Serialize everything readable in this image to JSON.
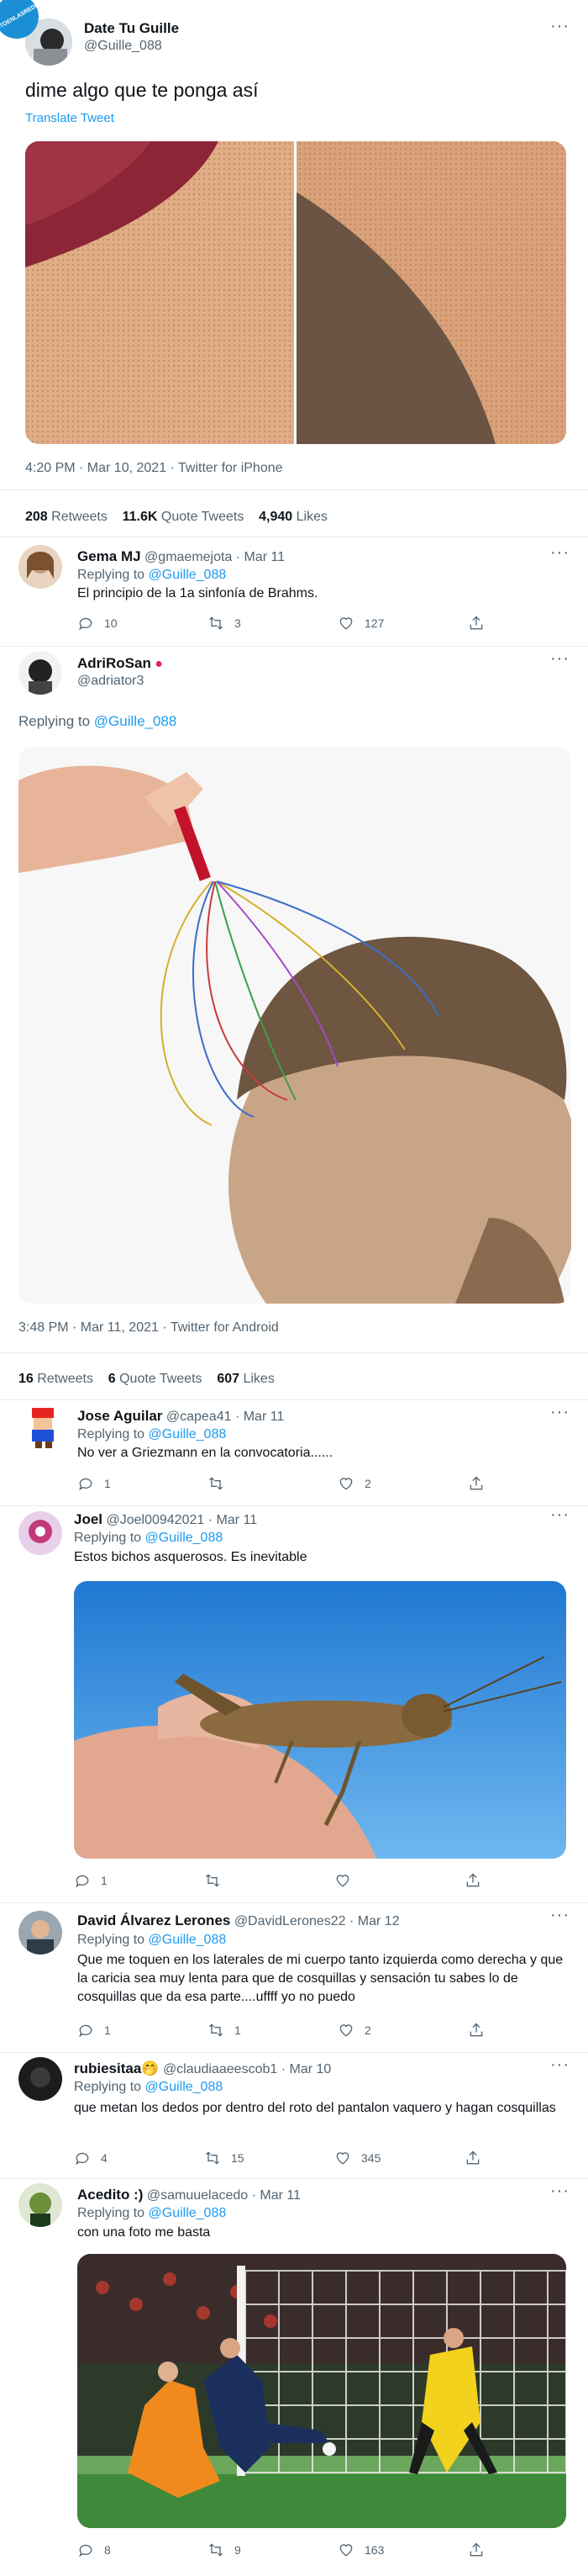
{
  "badge": "VISTOENLASREDES",
  "main": {
    "name": "Date Tu Guille",
    "handle": "@Guille_088",
    "text": "dime algo que te ponga así",
    "translate": "Translate Tweet",
    "meta": "4:20 PM · Mar 10, 2021 · Twitter for iPhone",
    "retweets_n": "208",
    "retweets_l": "Retweets",
    "quotes_n": "11.6K",
    "quotes_l": "Quote Tweets",
    "likes_n": "4,940",
    "likes_l": "Likes"
  },
  "reply1": {
    "name": "Gema MJ",
    "handle": "@gmaemejota · Mar 11",
    "replying": "Replying to",
    "to": "@Guille_088",
    "text": "El principio de la 1a sinfonía de Brahms.",
    "replies": "10",
    "rts": "3",
    "likes": "127"
  },
  "reply2": {
    "name": "AdriRoSan",
    "handle": "@adriator3",
    "replying": "Replying to",
    "to": "@Guille_088",
    "meta": "3:48 PM · Mar 11, 2021 · Twitter for Android",
    "retweets_n": "16",
    "retweets_l": "Retweets",
    "quotes_n": "6",
    "quotes_l": "Quote Tweets",
    "likes_n": "607",
    "likes_l": "Likes"
  },
  "reply3": {
    "name": "Jose Aguilar",
    "handle": "@capea41 · Mar 11",
    "replying": "Replying to",
    "to": "@Guille_088",
    "text": "No ver a Griezmann en la convocatoria......",
    "replies": "1",
    "rts": "",
    "likes": "2"
  },
  "reply4": {
    "name": "Joel",
    "handle": "@Joel00942021 · Mar 11",
    "replying": "Replying to",
    "to": "@Guille_088",
    "text": "Estos bichos asquerosos. Es inevitable",
    "replies": "1",
    "rts": "",
    "likes": ""
  },
  "reply5": {
    "name": "David Álvarez Lerones",
    "handle": "@DavidLerones22 · Mar 12",
    "replying": "Replying to",
    "to": "@Guille_088",
    "text": "Que me toquen en los laterales de mi cuerpo tanto izquierda como derecha y que la caricia sea muy lenta para que de cosquillas y sensación tu sabes lo de cosquillas que da esa parte....uffff yo no puedo",
    "replies": "1",
    "rts": "1",
    "likes": "2"
  },
  "reply6": {
    "name": "rubiesitaa🤭",
    "handle": "@claudiaaeescob1 · Mar 10",
    "replying": "Replying to",
    "to": "@Guille_088",
    "text": "que metan los dedos por dentro del roto del pantalon vaquero y hagan cosquillas",
    "replies": "4",
    "rts": "15",
    "likes": "345"
  },
  "reply7": {
    "name": "Acedito :)",
    "handle": "@samuuelacedo · Mar 11",
    "replying": "Replying to",
    "to": "@Guille_088",
    "text": "con una foto me basta",
    "replies": "8",
    "rts": "9",
    "likes": "163"
  }
}
